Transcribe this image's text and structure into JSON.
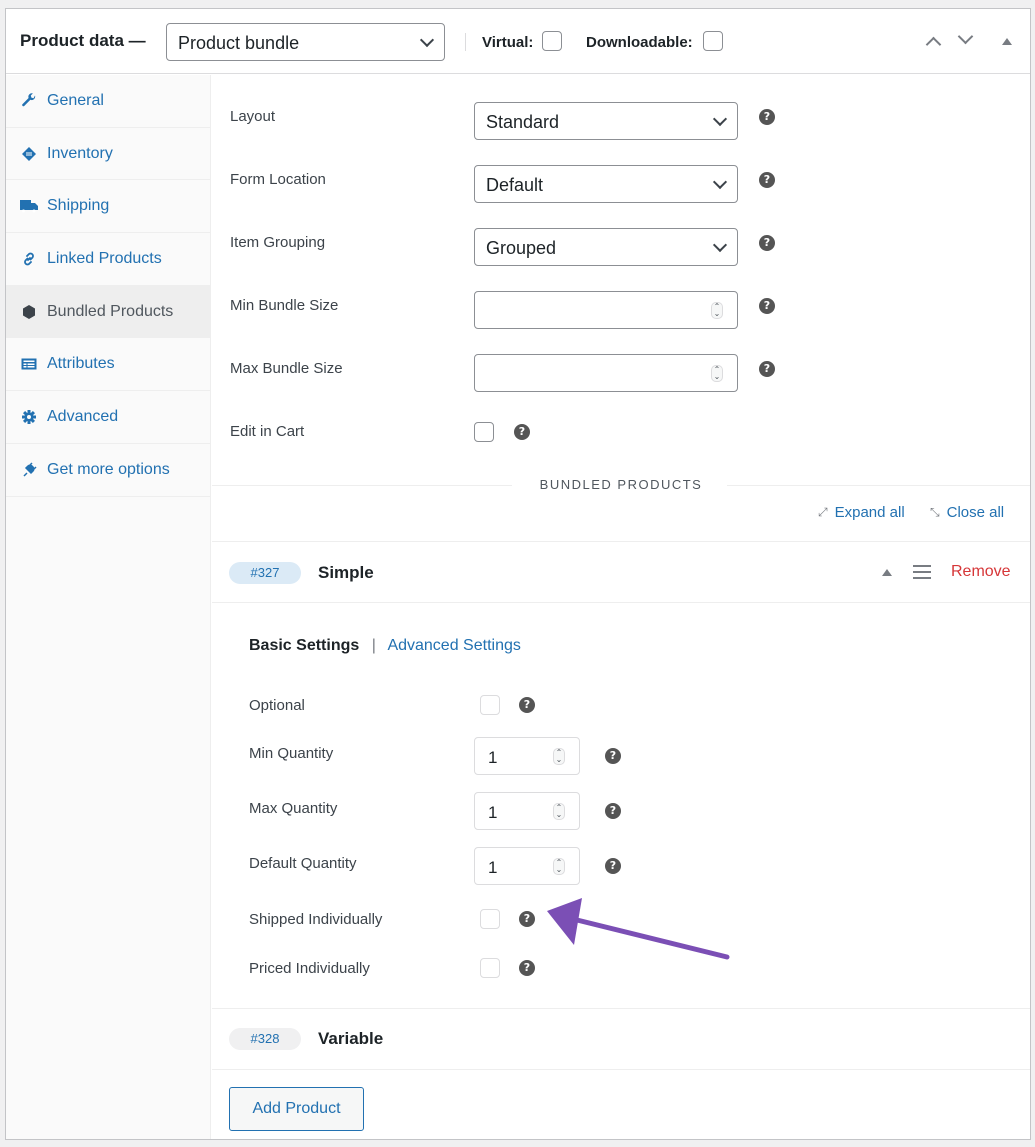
{
  "header": {
    "title": "Product data —",
    "product_type": "Product bundle",
    "virtual_label": "Virtual:",
    "virtual_checked": false,
    "downloadable_label": "Downloadable:",
    "downloadable_checked": false
  },
  "sidebar": {
    "items": [
      {
        "label": "General",
        "icon": "wrench-icon"
      },
      {
        "label": "Inventory",
        "icon": "tag-icon"
      },
      {
        "label": "Shipping",
        "icon": "truck-icon"
      },
      {
        "label": "Linked Products",
        "icon": "link-icon"
      },
      {
        "label": "Bundled Products",
        "icon": "hexagon-icon",
        "active": true
      },
      {
        "label": "Attributes",
        "icon": "list-card-icon"
      },
      {
        "label": "Advanced",
        "icon": "gear-icon"
      },
      {
        "label": "Get more options",
        "icon": "plug-icon"
      }
    ]
  },
  "bundle_settings": {
    "layout_label": "Layout",
    "layout_value": "Standard",
    "form_location_label": "Form Location",
    "form_location_value": "Default",
    "item_grouping_label": "Item Grouping",
    "item_grouping_value": "Grouped",
    "min_bundle_size_label": "Min Bundle Size",
    "min_bundle_size_value": "",
    "max_bundle_size_label": "Max Bundle Size",
    "max_bundle_size_value": "",
    "edit_in_cart_label": "Edit in Cart",
    "edit_in_cart_checked": false,
    "help_glyph": "?"
  },
  "bundled_products": {
    "section_title": "BUNDLED PRODUCTS",
    "expand_all": "Expand all",
    "close_all": "Close all",
    "items": [
      {
        "id": "#327",
        "name": "Simple",
        "remove_label": "Remove",
        "tabs": {
          "basic": "Basic Settings",
          "separator": "|",
          "advanced": "Advanced Settings"
        },
        "fields": {
          "optional_label": "Optional",
          "min_quantity_label": "Min Quantity",
          "min_quantity_value": "1",
          "max_quantity_label": "Max Quantity",
          "max_quantity_value": "1",
          "default_quantity_label": "Default Quantity",
          "default_quantity_value": "1",
          "shipped_individually_label": "Shipped Individually",
          "priced_individually_label": "Priced Individually"
        }
      },
      {
        "id": "#328",
        "name": "Variable"
      }
    ],
    "add_product_label": "Add Product"
  },
  "annotation": {
    "arrow_color": "#7b4fb5",
    "target": "Shipped Individually help"
  },
  "colors": {
    "link": "#2271b1",
    "remove": "#d63638",
    "badge_blue": "#dbeaf6"
  }
}
